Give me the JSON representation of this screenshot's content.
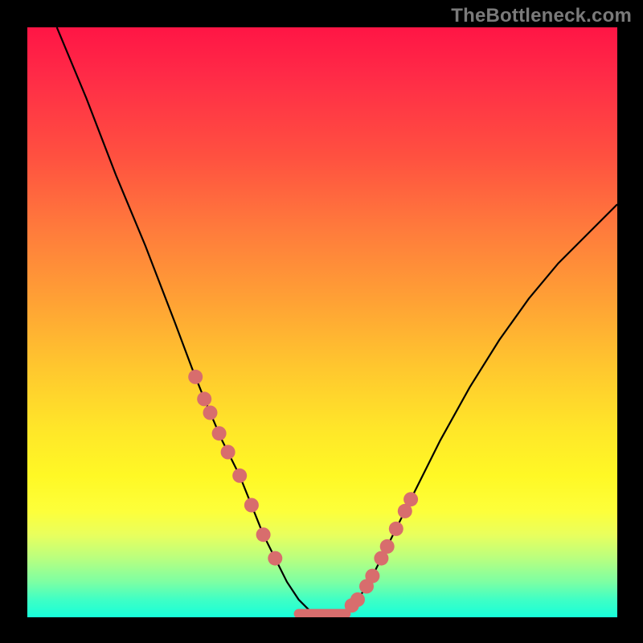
{
  "watermark": "TheBottleneck.com",
  "chart_data": {
    "type": "line",
    "title": "",
    "xlabel": "",
    "ylabel": "",
    "xlim": [
      0,
      100
    ],
    "ylim": [
      0,
      100
    ],
    "grid": false,
    "legend": false,
    "background": "rainbow-gradient",
    "series": [
      {
        "name": "bottleneck-curve",
        "x": [
          5,
          10,
          15,
          20,
          25,
          28,
          30,
          33,
          36,
          38,
          40,
          42,
          44,
          46,
          48,
          50,
          52,
          54,
          56,
          58,
          60,
          65,
          70,
          75,
          80,
          85,
          90,
          95,
          100
        ],
        "y": [
          100,
          88,
          75,
          63,
          50,
          42,
          37,
          30,
          24,
          19,
          14,
          10,
          6,
          3,
          1,
          0,
          0,
          1,
          3,
          6,
          10,
          20,
          30,
          39,
          47,
          54,
          60,
          65,
          70
        ]
      }
    ],
    "minimum_plateau": {
      "x_start": 46,
      "x_end": 54,
      "y": 0
    },
    "highlight_dots": {
      "color": "#d86d6d",
      "left_branch_x": [
        28.5,
        30,
        31,
        32.5,
        34,
        36,
        38,
        40,
        42
      ],
      "right_branch_x": [
        55,
        56,
        57.5,
        58.5,
        60,
        61,
        62.5,
        64,
        65
      ]
    }
  },
  "colors": {
    "frame": "#000000",
    "curve": "#000000",
    "dots": "#d86d6d",
    "watermark": "#7a7a7a"
  }
}
